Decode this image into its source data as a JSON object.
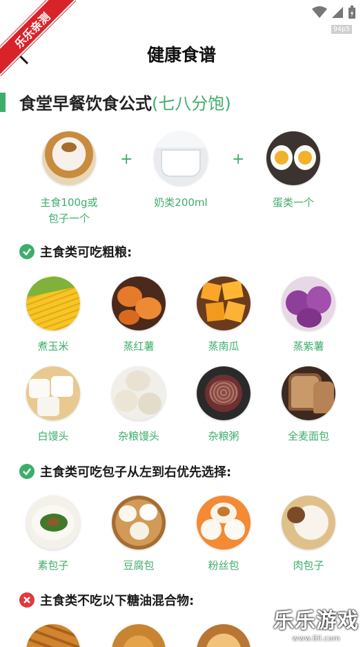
{
  "watermark_corner": "乐乐亲测",
  "status": {
    "fps": "94p5"
  },
  "header": {
    "title": "健康食谱"
  },
  "formula": {
    "title": "食堂早餐饮食公式",
    "title_accent": "(七八分饱)",
    "items": [
      {
        "label": "主食100g或\n包子一个",
        "icon": "bun"
      },
      {
        "label": "奶类200ml",
        "icon": "milk"
      },
      {
        "label": "蛋类一个",
        "icon": "egg"
      }
    ],
    "plus": "+"
  },
  "sections": [
    {
      "heading": "主食类可吃粗粮:",
      "status": "ok",
      "rows": [
        [
          {
            "label": "煮玉米",
            "icon": "corn"
          },
          {
            "label": "蒸红薯",
            "icon": "sweet-potato"
          },
          {
            "label": "蒸南瓜",
            "icon": "pumpkin"
          },
          {
            "label": "蒸紫薯",
            "icon": "purple-potato"
          }
        ],
        [
          {
            "label": "白馒头",
            "icon": "steamed-bun"
          },
          {
            "label": "杂粮馒头",
            "icon": "grain-bun"
          },
          {
            "label": "杂粮粥",
            "icon": "porridge"
          },
          {
            "label": "全麦面包",
            "icon": "bread"
          }
        ]
      ]
    },
    {
      "heading": "主食类可吃包子从左到右优先选择:",
      "status": "ok",
      "rows": [
        [
          {
            "label": "素包子",
            "icon": "veg-bun"
          },
          {
            "label": "豆腐包",
            "icon": "tofu-bun"
          },
          {
            "label": "粉丝包",
            "icon": "vermicelli-bun"
          },
          {
            "label": "肉包子",
            "icon": "meat-bun"
          }
        ]
      ]
    },
    {
      "heading": "主食类不吃以下糖油混合物:",
      "status": "no",
      "rows": [
        [
          {
            "label": "",
            "icon": "fried-dough"
          },
          {
            "label": "",
            "icon": "sesame-ball"
          },
          {
            "label": "",
            "icon": "fried-pastry"
          }
        ]
      ]
    }
  ],
  "bottom_watermark": {
    "brand": "乐乐游戏",
    "site": "www.6ll.com"
  },
  "colors": {
    "accent": "#3cae6a",
    "ok": "#3cae6a",
    "no": "#e0393e",
    "ribbon": "#d8232a"
  }
}
